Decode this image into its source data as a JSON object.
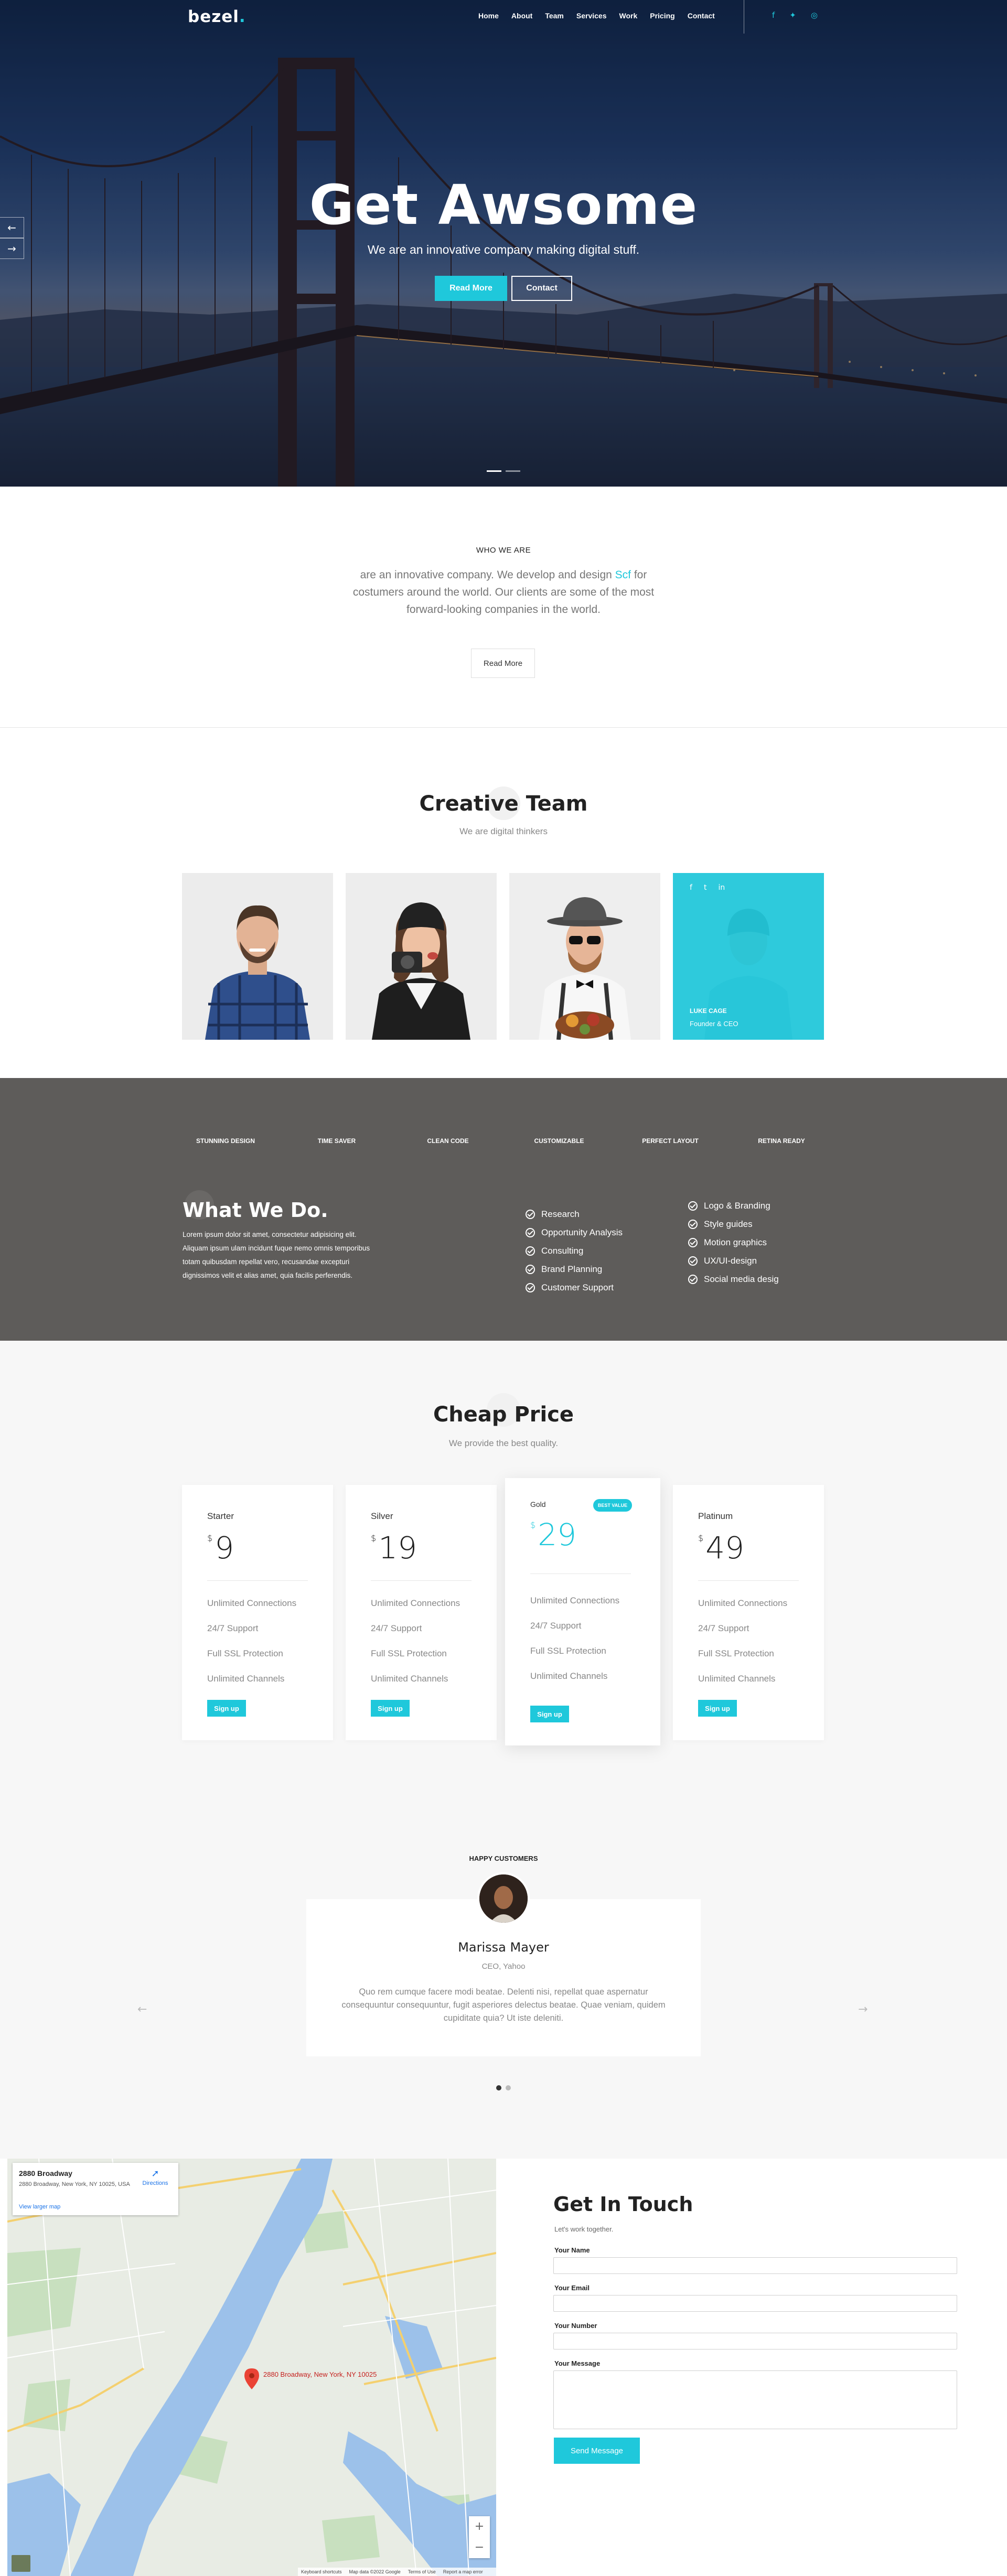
{
  "nav": {
    "logo": "bezel",
    "logo_dot": ".",
    "links": [
      "Home",
      "About",
      "Team",
      "Services",
      "Work",
      "Pricing",
      "Contact"
    ],
    "social": [
      "facebook-icon",
      "twitter-icon",
      "instagram-icon"
    ]
  },
  "hero": {
    "title": "Get Awsome",
    "subtitle": "We are an innovative company making digital stuff.",
    "primary_button": "Read More",
    "secondary_button": "Contact",
    "prev_arrow": "←",
    "next_arrow": "→",
    "slides_total": 2,
    "active_slide": 1
  },
  "who": {
    "eyebrow": "WHO WE ARE",
    "text_before": "are an innovative company. We develop and design ",
    "text_accent": "Scf",
    "text_after": " for costumers around the world. Our clients are some of the most forward-looking companies in the world.",
    "button": "Read More"
  },
  "team": {
    "title": "Creative Team",
    "subtitle": "We are digital thinkers",
    "highlighted_member": {
      "name": "LUKE CAGE",
      "role": "Founder & CEO",
      "social": [
        "f",
        "t",
        "in"
      ]
    }
  },
  "whatwedo": {
    "features": [
      "STUNNING DESIGN",
      "TIME SAVER",
      "CLEAN CODE",
      "CUSTOMIZABLE",
      "PERFECT LAYOUT",
      "RETINA READY"
    ],
    "title": "What We Do.",
    "text": "Lorem ipsum dolor sit amet, consectetur adipisicing elit. Aliquam ipsum ulam incidunt fuque nemo omnis temporibus totam quibusdam repellat vero, recusandae excepturi dignissimos velit et alias amet, quia facilis perferendis.",
    "services_col1": [
      "Research",
      "Opportunity Analysis",
      "Consulting",
      "Brand Planning",
      "Customer Support"
    ],
    "services_col2": [
      "Logo & Branding",
      "Style guides",
      "Motion graphics",
      "UX/UI-design",
      "Social media desig"
    ]
  },
  "pricing": {
    "title": "Cheap Price",
    "subtitle": "We provide the best quality.",
    "currency": "$",
    "plans": [
      {
        "name": "Starter",
        "price": "9",
        "features": [
          "Unlimited Connections",
          "24/7 Support",
          "Full SSL Protection",
          "Unlimited Channels"
        ],
        "button": "Sign up"
      },
      {
        "name": "Silver",
        "price": "19",
        "features": [
          "Unlimited Connections",
          "24/7 Support",
          "Full SSL Protection",
          "Unlimited Channels"
        ],
        "button": "Sign up"
      },
      {
        "name": "Gold",
        "price": "29",
        "badge": "BEST VALUE",
        "features": [
          "Unlimited Connections",
          "24/7 Support",
          "Full SSL Protection",
          "Unlimited Channels"
        ],
        "button": "Sign up"
      },
      {
        "name": "Platinum",
        "price": "49",
        "features": [
          "Unlimited Connections",
          "24/7 Support",
          "Full SSL Protection",
          "Unlimited Channels"
        ],
        "button": "Sign up"
      }
    ],
    "accent_color": "#1fc8db"
  },
  "testimonial": {
    "eyebrow": "HAPPY CUSTOMERS",
    "name": "Marissa Mayer",
    "role": "CEO, Yahoo",
    "quote": "Quo rem cumque facere modi beatae. Delenti nisi, repellat quae aspernatur consequuntur consequuntur, fugit asperiores delectus beatae. Quae veniam, quidem cupiditate quia? Ut iste deleniti.",
    "prev": "←",
    "next": "→"
  },
  "map": {
    "place": "2880 Broadway",
    "address": "2880 Broadway, New York, NY 10025, USA",
    "larger_map": "View larger map",
    "directions": "Directions",
    "zoom_in": "+",
    "zoom_out": "−",
    "footer": [
      "Keyboard shortcuts",
      "Map data ©2022 Google",
      "Terms of Use",
      "Report a map error"
    ],
    "pin_label": "2880 Broadway, New York, NY 10025"
  },
  "contact": {
    "title": "Get In Touch",
    "subtitle": "Let's work together.",
    "name_label": "Your Name",
    "email_label": "Your Email",
    "number_label": "Your Number",
    "message_label": "Your Message",
    "button": "Send Message"
  }
}
